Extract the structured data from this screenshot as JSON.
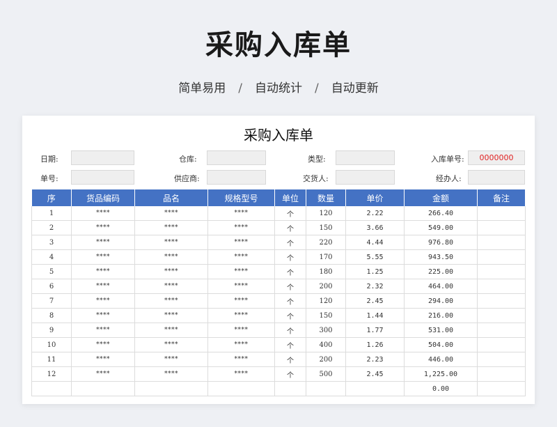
{
  "hero": {
    "title": "采购入库单",
    "subtitle": [
      "简单易用",
      "自动统计",
      "自动更新"
    ],
    "separator": "/"
  },
  "sheet": {
    "title": "采购入库单",
    "meta": {
      "date_label": "日期:",
      "warehouse_label": "仓库:",
      "type_label": "类型:",
      "receipt_no_label": "入库单号:",
      "receipt_no_value": "0000000",
      "order_no_label": "单号:",
      "supplier_label": "供应商:",
      "deliverer_label": "交货人:",
      "handler_label": "经办人:"
    },
    "columns": [
      "序",
      "货品编码",
      "品名",
      "规格型号",
      "单位",
      "数量",
      "单价",
      "金额",
      "备注"
    ],
    "rows": [
      [
        "1",
        "****",
        "****",
        "****",
        "个",
        "120",
        "2.22",
        "266.40",
        ""
      ],
      [
        "2",
        "****",
        "****",
        "****",
        "个",
        "150",
        "3.66",
        "549.00",
        ""
      ],
      [
        "3",
        "****",
        "****",
        "****",
        "个",
        "220",
        "4.44",
        "976.80",
        ""
      ],
      [
        "4",
        "****",
        "****",
        "****",
        "个",
        "170",
        "5.55",
        "943.50",
        ""
      ],
      [
        "5",
        "****",
        "****",
        "****",
        "个",
        "180",
        "1.25",
        "225.00",
        ""
      ],
      [
        "6",
        "****",
        "****",
        "****",
        "个",
        "200",
        "2.32",
        "464.00",
        ""
      ],
      [
        "7",
        "****",
        "****",
        "****",
        "个",
        "120",
        "2.45",
        "294.00",
        ""
      ],
      [
        "8",
        "****",
        "****",
        "****",
        "个",
        "150",
        "1.44",
        "216.00",
        ""
      ],
      [
        "9",
        "****",
        "****",
        "****",
        "个",
        "300",
        "1.77",
        "531.00",
        ""
      ],
      [
        "10",
        "****",
        "****",
        "****",
        "个",
        "400",
        "1.26",
        "504.00",
        ""
      ],
      [
        "11",
        "****",
        "****",
        "****",
        "个",
        "200",
        "2.23",
        "446.00",
        ""
      ],
      [
        "12",
        "****",
        "****",
        "****",
        "个",
        "500",
        "2.45",
        "1,225.00",
        ""
      ],
      [
        "",
        "",
        "",
        "",
        "",
        "",
        "",
        "0.00",
        ""
      ]
    ],
    "colors": {
      "header_bg": "#4472c4",
      "receipt_no": "#e02020"
    }
  }
}
